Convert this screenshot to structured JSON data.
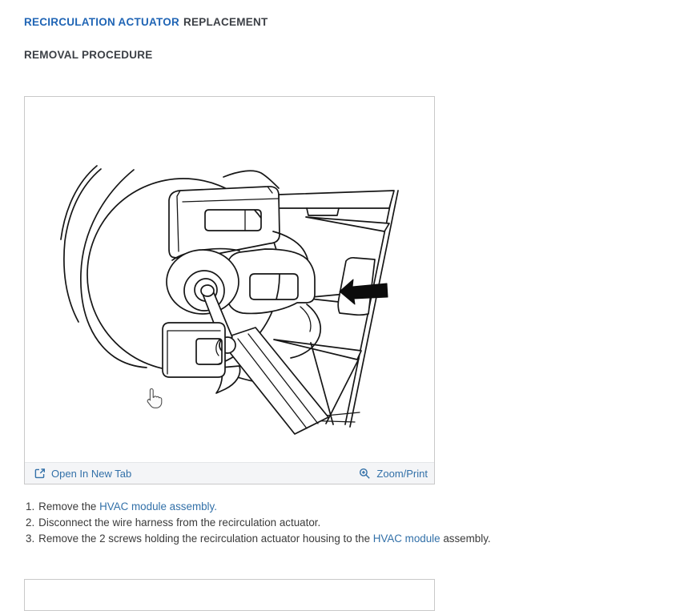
{
  "header": {
    "title_link": "RECIRCULATION ACTUATOR",
    "title_rest": "REPLACEMENT",
    "subtitle": "REMOVAL PROCEDURE"
  },
  "figure": {
    "toolbar": {
      "open_in_new_tab_label": "Open In New Tab",
      "zoom_print_label": "Zoom/Print"
    },
    "icons": {
      "open_in_new_tab": "open-in-new-tab-icon",
      "zoom_print": "magnifier-plus-icon",
      "arrow_marker": "removal-direction-arrow",
      "cursor": "hand-pointer-cursor"
    }
  },
  "procedure": {
    "steps": [
      {
        "num": "1.",
        "pre": "Remove the ",
        "link": "HVAC module assembly.",
        "post": ""
      },
      {
        "num": "2.",
        "pre": "Disconnect the wire harness from the recirculation actuator.",
        "link": "",
        "post": ""
      },
      {
        "num": "3.",
        "pre": "Remove the 2 screws holding the recirculation actuator housing to the ",
        "link": "HVAC module",
        "post": " assembly."
      }
    ]
  },
  "colors": {
    "heading_blue": "#2065b5",
    "heading_dark": "#3b3f45",
    "link_blue": "#3270a8",
    "frame_border": "#c9c9c9",
    "toolbar_bg": "#f4f5f7"
  }
}
